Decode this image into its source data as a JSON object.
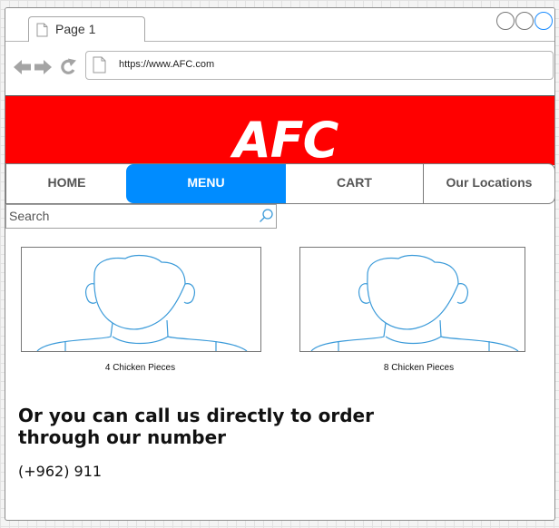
{
  "browser": {
    "tab_title": "Page 1",
    "url": "https://www.AFC.com"
  },
  "site": {
    "logo_text": "AFC",
    "brand_color": "#ff0000",
    "accent_color": "#008cff"
  },
  "nav": {
    "items": [
      {
        "label": "HOME",
        "active": false
      },
      {
        "label": "MENU",
        "active": true
      },
      {
        "label": "CART",
        "active": false
      },
      {
        "label": "Our Locations",
        "active": false
      }
    ]
  },
  "search": {
    "placeholder": "Search",
    "icon": "search-icon"
  },
  "products": [
    {
      "caption": "4 Chicken Pieces",
      "image_icon": "person-placeholder-icon"
    },
    {
      "caption": "8 Chicken Pieces",
      "image_icon": "person-placeholder-icon"
    }
  ],
  "contact": {
    "line1": "Or you can call us directly to order",
    "line2": "through our number",
    "phone": "(+962) 911"
  }
}
